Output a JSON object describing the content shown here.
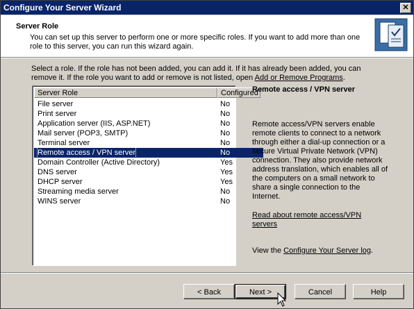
{
  "window": {
    "title": "Configure Your Server Wizard",
    "close_label": "✕"
  },
  "header": {
    "title": "Server Role",
    "description": "You can set up this server to perform one or more specific roles. If you want to add more than one role to this server, you can run this wizard again."
  },
  "intro": {
    "text": "Select a role. If the role has not been added, you can add it. If it has already been added, you can remove it. If the role you want to add or remove is not listed, open ",
    "link": "Add or Remove Programs",
    "suffix": "."
  },
  "roles": {
    "headers": [
      "Server Role",
      "Configured"
    ],
    "rows": [
      {
        "name": "File server",
        "configured": "No"
      },
      {
        "name": "Print server",
        "configured": "No"
      },
      {
        "name": "Application server (IIS, ASP.NET)",
        "configured": "No"
      },
      {
        "name": "Mail server (POP3, SMTP)",
        "configured": "No"
      },
      {
        "name": "Terminal server",
        "configured": "No"
      },
      {
        "name": "Remote access / VPN server",
        "configured": "No",
        "selected": true
      },
      {
        "name": "Domain Controller (Active Directory)",
        "configured": "Yes"
      },
      {
        "name": "DNS server",
        "configured": "Yes"
      },
      {
        "name": "DHCP server",
        "configured": "Yes"
      },
      {
        "name": "Streaming media server",
        "configured": "No"
      },
      {
        "name": "WINS server",
        "configured": "No"
      }
    ]
  },
  "details": {
    "title": "Remote access / VPN server",
    "body": "Remote access/VPN servers enable remote clients to connect to a network through either a dial-up connection or a secure Virtual Private Network (VPN) connection. They also provide network address translation, which enables all of the computers on a small network to share a single connection to the Internet.",
    "read_link": "Read about remote access/VPN servers",
    "log_prefix": "View the ",
    "log_link": "Configure Your Server log",
    "log_suffix": "."
  },
  "buttons": {
    "back": "< Back",
    "next": "Next >",
    "cancel": "Cancel",
    "help": "Help"
  },
  "colors": {
    "titlebar": "#0a246a",
    "selection": "#0a246a",
    "face": "#d4d0c8"
  }
}
